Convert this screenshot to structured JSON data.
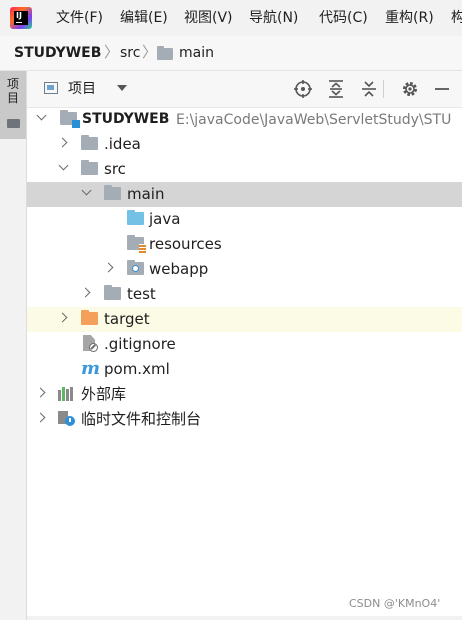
{
  "menubar": {
    "items": [
      "文件(F)",
      "编辑(E)",
      "视图(V)",
      "导航(N)",
      "代码(C)",
      "重构(R)",
      "构"
    ]
  },
  "breadcrumb": {
    "project": "STUDYWEB",
    "src": "src",
    "main": "main"
  },
  "stripe": {
    "label": "项目"
  },
  "panel": {
    "title": "项目",
    "tools": [
      "locate-icon",
      "expand-all-icon",
      "collapse-all-icon",
      "gear-icon",
      "minimize-icon"
    ]
  },
  "tree": {
    "root": {
      "name": "STUDYWEB",
      "path": "E:\\javaCode\\JavaWeb\\ServletStudy\\STU"
    },
    "idea": ".idea",
    "src": "src",
    "main": "main",
    "java": "java",
    "resources": "resources",
    "webapp": "webapp",
    "test": "test",
    "target": "target",
    "gitignore": ".gitignore",
    "pom": "pom.xml",
    "libs": "外部库",
    "scratches": "临时文件和控制台"
  },
  "watermark": "CSDN @'KMnO4'",
  "colors": {
    "folder": "#a4adb6",
    "source_folder": "#73c2e6",
    "excluded_folder": "#f5a05a",
    "selection": "#d5d5d5",
    "maven": "#3b98d9"
  }
}
